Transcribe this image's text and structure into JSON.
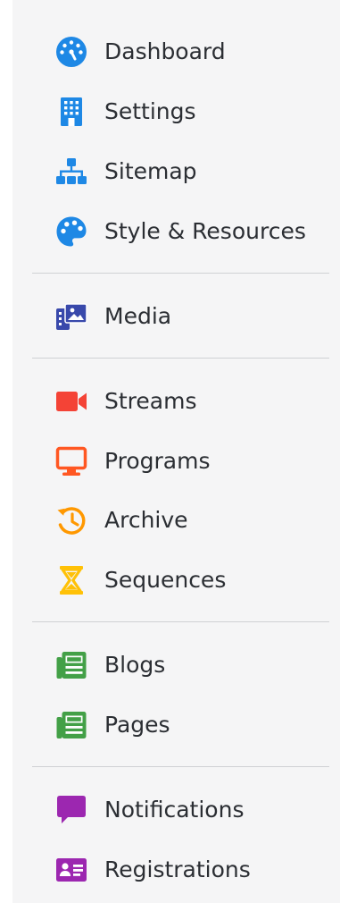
{
  "colors": {
    "sidebar_bg": "#f5f5f6",
    "text": "#2b2e33",
    "divider": "#cfd1d4",
    "blue": "#1e88e5",
    "indigo": "#3949ab",
    "red": "#f44336",
    "orange": "#ff5722",
    "amber": "#ff9800",
    "yellow": "#ffc107",
    "green": "#43a047",
    "purple": "#9c27b0"
  },
  "sidebar": {
    "items": [
      {
        "label": "Dashboard",
        "icon": "dashboard-icon",
        "color": "#1e88e5"
      },
      {
        "label": "Settings",
        "icon": "building-icon",
        "color": "#1e88e5"
      },
      {
        "label": "Sitemap",
        "icon": "sitemap-icon",
        "color": "#1e88e5"
      },
      {
        "label": "Style & Resources",
        "icon": "palette-icon",
        "color": "#1e88e5"
      },
      {
        "label": "Media",
        "icon": "media-icon",
        "color": "#3949ab"
      },
      {
        "label": "Streams",
        "icon": "video-camera-icon",
        "color": "#f44336"
      },
      {
        "label": "Programs",
        "icon": "monitor-icon",
        "color": "#ff5722"
      },
      {
        "label": "Archive",
        "icon": "history-icon",
        "color": "#ff9800"
      },
      {
        "label": "Sequences",
        "icon": "hourglass-icon",
        "color": "#ffc107"
      },
      {
        "label": "Blogs",
        "icon": "newspaper-icon",
        "color": "#43a047"
      },
      {
        "label": "Pages",
        "icon": "newspaper-icon",
        "color": "#43a047"
      },
      {
        "label": "Notifications",
        "icon": "chat-bubble-icon",
        "color": "#9c27b0"
      },
      {
        "label": "Registrations",
        "icon": "id-card-icon",
        "color": "#9c27b0"
      }
    ]
  }
}
